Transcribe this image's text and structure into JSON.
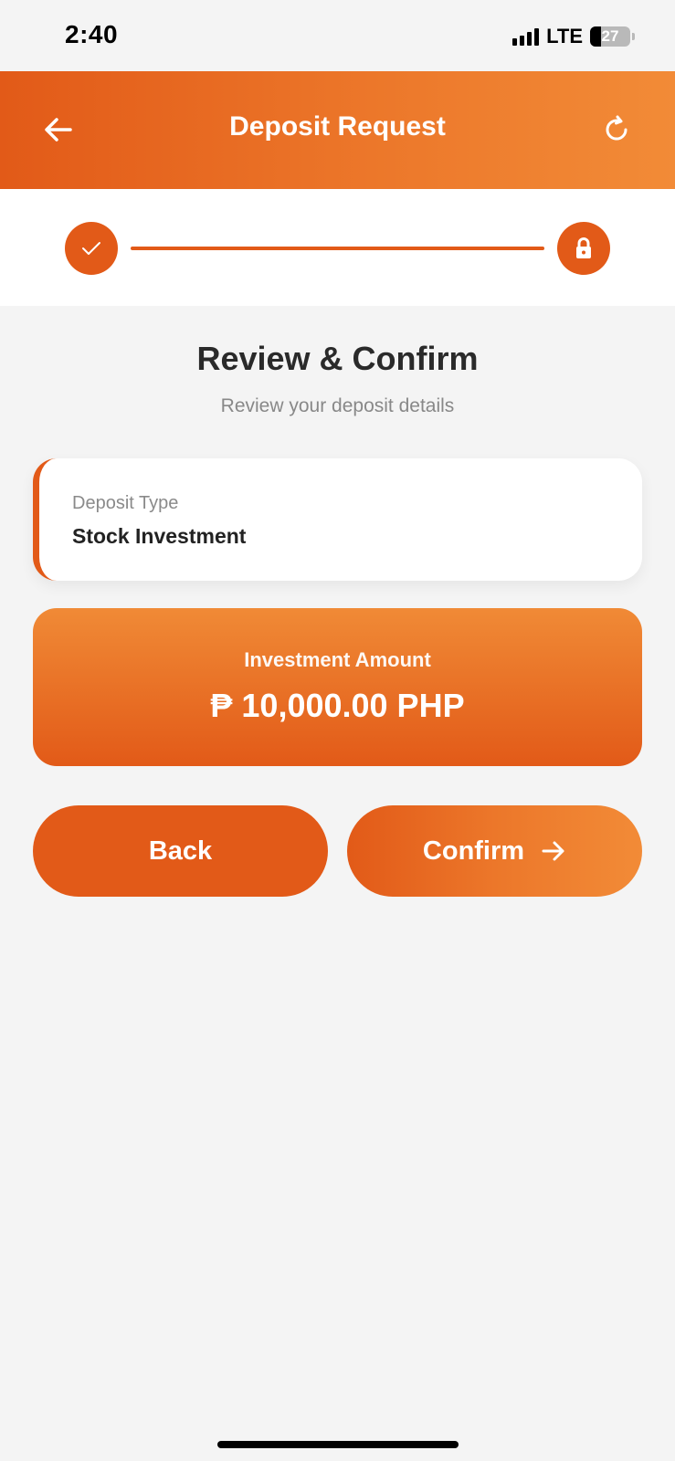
{
  "status_bar": {
    "time": "2:40",
    "network": "LTE",
    "battery": "27"
  },
  "header": {
    "title": "Deposit Request",
    "back_icon": "arrow-left-icon",
    "refresh_icon": "refresh-icon",
    "background_start": "#e25a18",
    "background_end": "#f28b37"
  },
  "stepper": {
    "step1_icon": "check-icon",
    "step2_icon": "lock-icon",
    "accent": "#e25a18"
  },
  "review": {
    "title": "Review & Confirm",
    "subtitle": "Review your deposit details"
  },
  "deposit_type": {
    "label": "Deposit Type",
    "value": "Stock Investment"
  },
  "amount": {
    "label": "Investment Amount",
    "value": "₱ 10,000.00 PHP"
  },
  "buttons": {
    "back_label": "Back",
    "confirm_label": "Confirm",
    "confirm_icon": "arrow-right-icon"
  }
}
